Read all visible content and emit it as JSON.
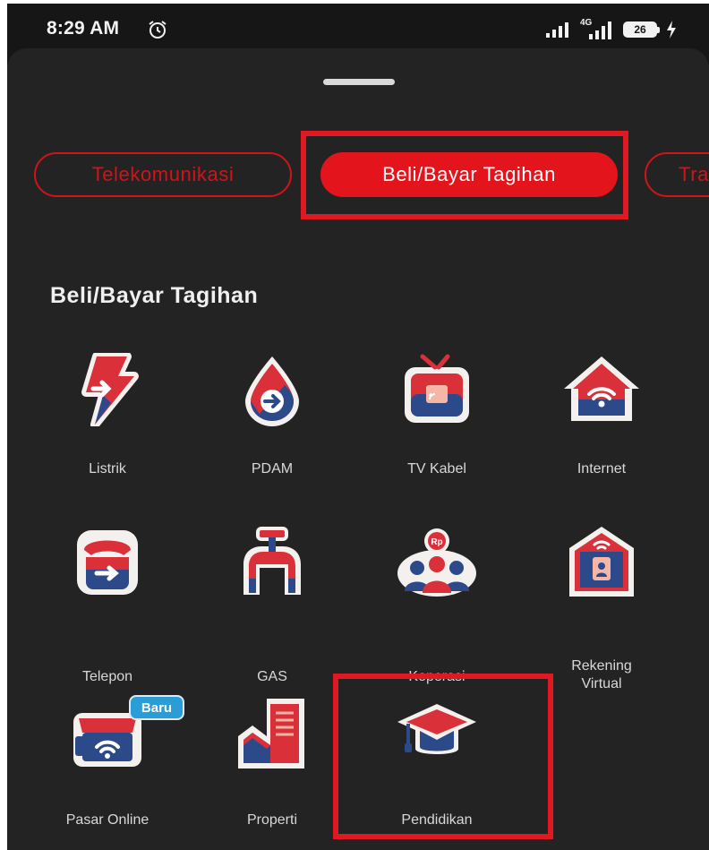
{
  "status_bar": {
    "time": "8:29 AM",
    "battery": "26",
    "network": "4G"
  },
  "tabs": [
    {
      "label": "Telekomunikasi",
      "active": false
    },
    {
      "label": "Beli/Bayar Tagihan",
      "active": true
    },
    {
      "label": "Tra",
      "active": false
    }
  ],
  "section_title": "Beli/Bayar Tagihan",
  "items": [
    {
      "label": "Listrik",
      "icon": "electricity-icon"
    },
    {
      "label": "PDAM",
      "icon": "water-icon"
    },
    {
      "label": "TV Kabel",
      "icon": "tv-icon"
    },
    {
      "label": "Internet",
      "icon": "internet-icon"
    },
    {
      "label": "Telepon",
      "icon": "phone-icon"
    },
    {
      "label": "GAS",
      "icon": "gas-icon"
    },
    {
      "label": "Koperasi",
      "icon": "cooperative-icon"
    },
    {
      "label": "Rekening Virtual",
      "label_line1": "Rekening",
      "label_line2": "Virtual",
      "icon": "virtual-account-icon"
    },
    {
      "label": "Pasar Online",
      "icon": "online-market-icon",
      "badge": "Baru"
    },
    {
      "label": "Properti",
      "icon": "property-icon"
    },
    {
      "label": "Pendidikan",
      "icon": "education-icon"
    }
  ],
  "colors": {
    "accent": "#e3141c",
    "highlight": "#e01822",
    "background": "#232323",
    "icon_blue": "#2c4a8a",
    "icon_red": "#d9303a"
  }
}
